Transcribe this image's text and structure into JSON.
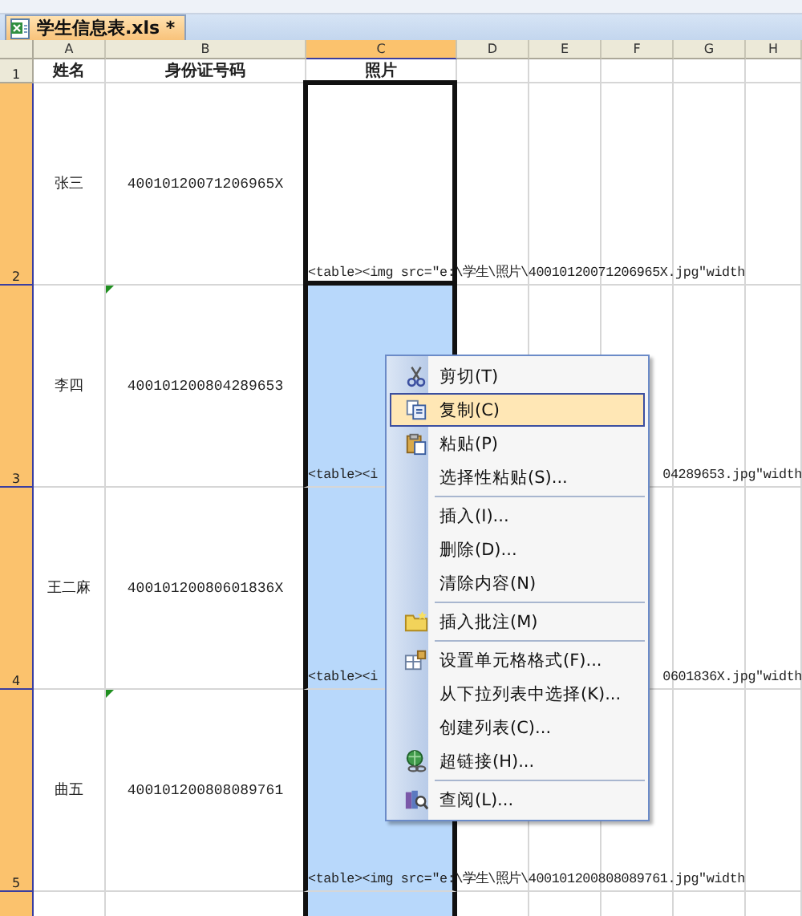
{
  "workbook_tab": {
    "title": "学生信息表.xls *",
    "selected": true
  },
  "columns": [
    {
      "label": "A",
      "selected": false
    },
    {
      "label": "B",
      "selected": false
    },
    {
      "label": "C",
      "selected": true
    },
    {
      "label": "D",
      "selected": false
    },
    {
      "label": "E",
      "selected": false
    },
    {
      "label": "F",
      "selected": false
    },
    {
      "label": "G",
      "selected": false
    },
    {
      "label": "H",
      "selected": false
    }
  ],
  "rows": [
    {
      "number": "1",
      "selected": false,
      "name": "姓名",
      "id": "身份证号码",
      "photo": "照片",
      "header": true,
      "flag": false,
      "photo_selected": false,
      "active": false,
      "overflow": []
    },
    {
      "number": "2",
      "selected": true,
      "name": "张三",
      "id": "40010120071206965X",
      "photo": "",
      "header": false,
      "flag": false,
      "photo_selected": false,
      "active": true,
      "overflow": [
        "<table><img src=\"e:\\学生\\照片\\40010120071206965X.jpg\"width"
      ]
    },
    {
      "number": "3",
      "selected": true,
      "name": "李四",
      "id": "400101200804289653",
      "header": false,
      "flag": true,
      "photo_selected": true,
      "active": false,
      "overflow": [
        "<table><i",
        "04289653.jpg\"width"
      ]
    },
    {
      "number": "4",
      "selected": true,
      "name": "王二麻",
      "id": "40010120080601836X",
      "header": false,
      "flag": false,
      "photo_selected": true,
      "active": false,
      "overflow": [
        "<table><i",
        "0601836X.jpg\"width"
      ]
    },
    {
      "number": "5",
      "selected": true,
      "name": "曲五",
      "id": "400101200808089761",
      "header": false,
      "flag": true,
      "photo_selected": true,
      "active": false,
      "overflow": [
        "<table><img src=\"e:\\学生\\照片\\400101200808089761.jpg\"width"
      ]
    }
  ],
  "context_menu": [
    {
      "label": "剪切(T)",
      "kind": "cut",
      "selected": false,
      "separator_before": false
    },
    {
      "label": "复制(C)",
      "kind": "copy",
      "selected": true,
      "separator_before": false
    },
    {
      "label": "粘贴(P)",
      "kind": "paste",
      "selected": false,
      "separator_before": false
    },
    {
      "label": "选择性粘贴(S)...",
      "kind": "plain",
      "selected": false,
      "separator_before": false
    },
    {
      "label": "插入(I)...",
      "kind": "plain",
      "selected": false,
      "separator_before": true
    },
    {
      "label": "删除(D)...",
      "kind": "plain",
      "selected": false,
      "separator_before": false
    },
    {
      "label": "清除内容(N)",
      "kind": "plain",
      "selected": false,
      "separator_before": false
    },
    {
      "label": "插入批注(M)",
      "kind": "comment",
      "selected": false,
      "separator_before": true
    },
    {
      "label": "设置单元格格式(F)...",
      "kind": "format",
      "selected": false,
      "separator_before": true
    },
    {
      "label": "从下拉列表中选择(K)...",
      "kind": "plain",
      "selected": false,
      "separator_before": false
    },
    {
      "label": "创建列表(C)...",
      "kind": "plain",
      "selected": false,
      "separator_before": false
    },
    {
      "label": "超链接(H)...",
      "kind": "link",
      "selected": false,
      "separator_before": false
    },
    {
      "label": "查阅(L)...",
      "kind": "lookup",
      "selected": false,
      "separator_before": true
    }
  ]
}
